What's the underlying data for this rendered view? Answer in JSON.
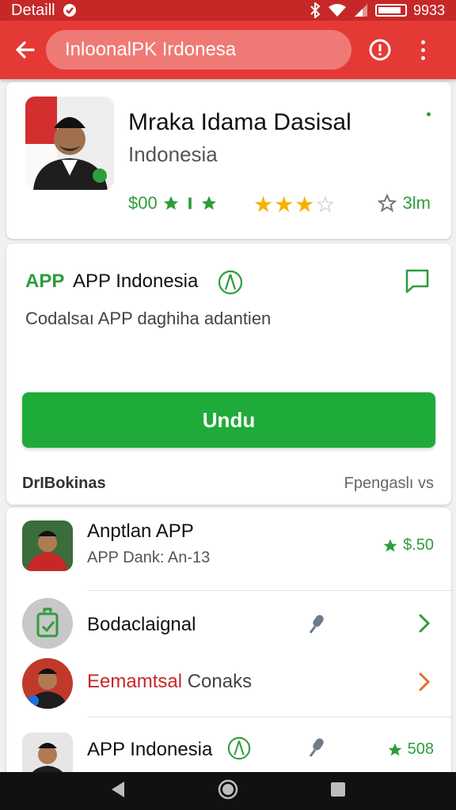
{
  "status_bar": {
    "left_text": "Detaill",
    "right_text": "9933"
  },
  "app_bar": {
    "search_text": "InloonalPK Irdonesa"
  },
  "header": {
    "app_title": "Mraka Idama Dasisal",
    "country": "Indonesia",
    "price_text": "$00",
    "rating_stars": 3.5,
    "size_text": "3lm"
  },
  "install": {
    "brand_tag": "APP",
    "title": "APP Indonesia",
    "description": "Codalsaı APP daghiha adantien",
    "download_label": "Undu",
    "section_left": "DrIBokinas",
    "section_right": "Fpengaslı vs"
  },
  "list": [
    {
      "title": "Anptlan APP",
      "subtitle": "APP Dank: An-13",
      "right_text": "$.50"
    },
    {
      "title": "Bodaclaignal"
    },
    {
      "title_highlight": "Eemamtsal",
      "title_rest": "Conaks"
    },
    {
      "title": "APP Indonesia",
      "right_text": "508"
    }
  ],
  "colors": {
    "brand_red": "#e53935",
    "accent_green": "#1fab3a",
    "star_yellow": "#f5b300"
  }
}
